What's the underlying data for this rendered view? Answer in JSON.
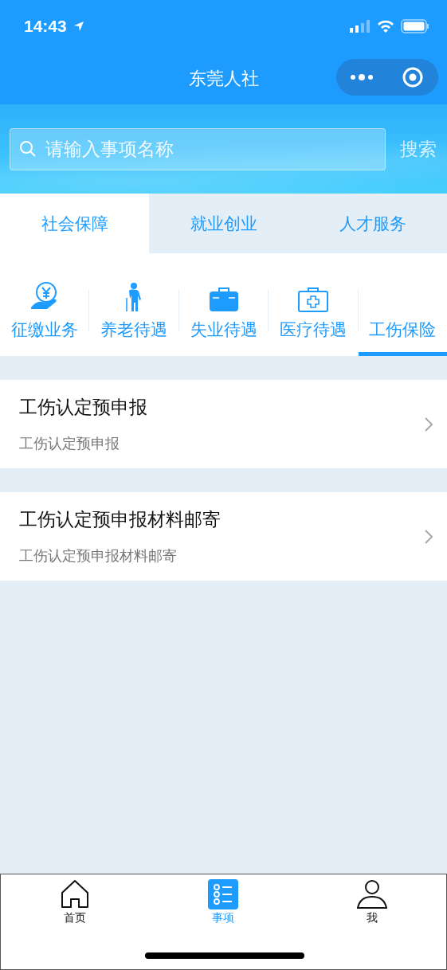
{
  "status_bar": {
    "time": "14:43"
  },
  "nav_bar": {
    "title": "东莞人社"
  },
  "search": {
    "placeholder": "请输入事项名称",
    "button": "搜索"
  },
  "tabs": [
    {
      "label": "社会保障",
      "selected": true
    },
    {
      "label": "就业创业",
      "selected": false
    },
    {
      "label": "人才服务",
      "selected": false
    }
  ],
  "categories": [
    {
      "label": "征缴业务",
      "kind": "coin",
      "selected": false
    },
    {
      "label": "养老待遇",
      "kind": "elder",
      "selected": false
    },
    {
      "label": "失业待遇",
      "kind": "briefcase",
      "selected": false
    },
    {
      "label": "医疗待遇",
      "kind": "medkit",
      "selected": false
    },
    {
      "label": "工伤保险",
      "selected": true
    }
  ],
  "items": [
    {
      "title": "工伤认定预申报",
      "subtitle": "工伤认定预申报"
    },
    {
      "title": "工伤认定预申报材料邮寄",
      "subtitle": "工伤认定预申报材料邮寄"
    }
  ],
  "tab_bar": [
    {
      "label": "首页",
      "kind": "home",
      "selected": false
    },
    {
      "label": "事项",
      "kind": "list",
      "selected": true
    },
    {
      "label": "我",
      "kind": "person",
      "selected": false
    }
  ]
}
